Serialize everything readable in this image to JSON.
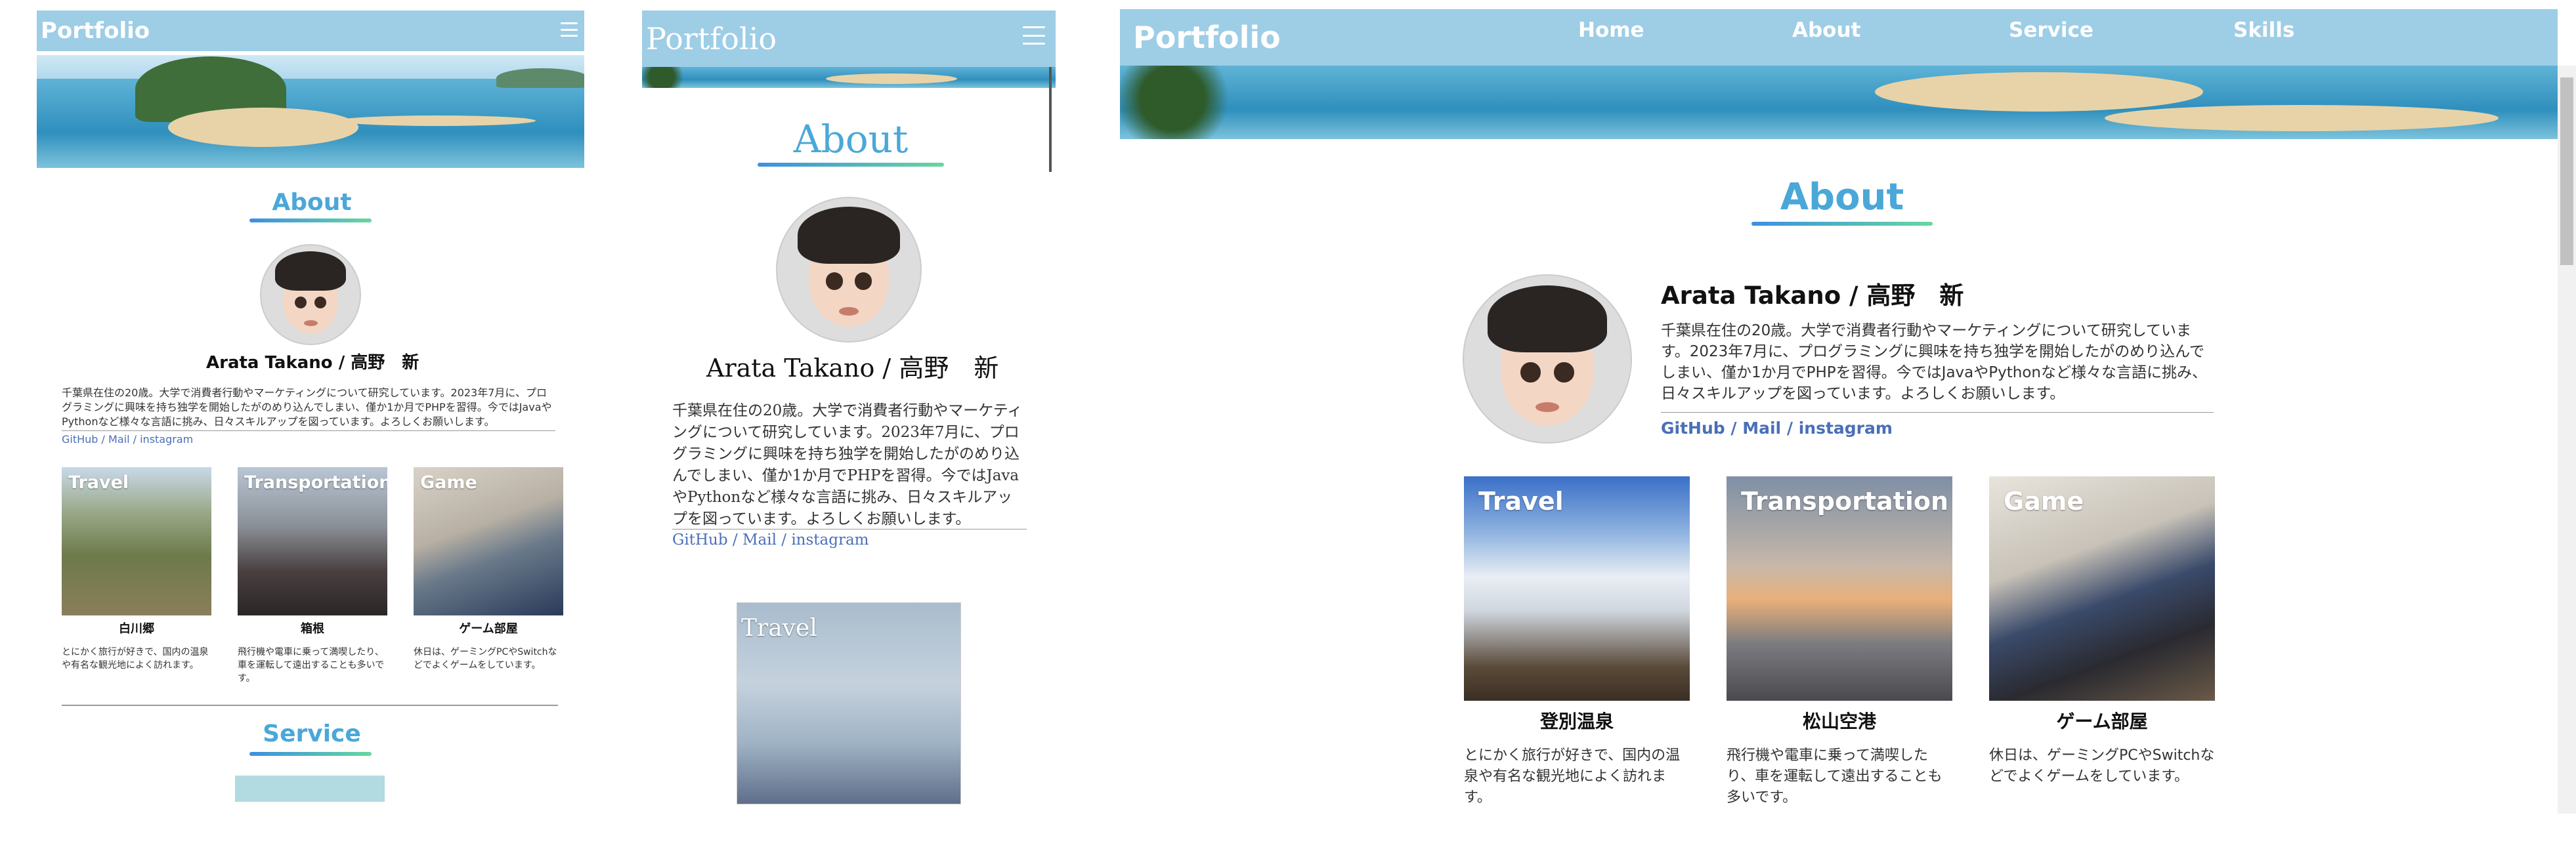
{
  "colors": {
    "header": "#9ecde6",
    "accent": "#4aa8d8",
    "link": "#4a6fb8"
  },
  "logo": "Portfolio",
  "nav": [
    "Home",
    "About",
    "Service",
    "Skills"
  ],
  "about": {
    "title": "About",
    "name": "Arata Takano / 高野　新",
    "bio": "千葉県在住の20歳。大学で消費者行動やマーケティングについて研究しています。2023年7月に、プログラミングに興味を持ち独学を開始したがのめり込んでしまい、僅か1か月でPHPを習得。今ではJavaやPythonなど様々な言語に挑み、日々スキルアップを図っています。よろしくお願いします。",
    "links": {
      "github": "GitHub",
      "mail": "Mail",
      "instagram": "instagram",
      "sep": "/"
    }
  },
  "service": {
    "title": "Service"
  },
  "mobile": {
    "cards": [
      {
        "label": "Travel",
        "caption": "白川郷",
        "desc": "とにかく旅行が好きで、国内の温泉や有名な観光地によく訪れます。"
      },
      {
        "label": "Transportation",
        "caption": "箱根",
        "desc": "飛行機や電車に乗って満喫したり、車を運転して遠出することも多いです。"
      },
      {
        "label": "Game",
        "caption": "ゲーム部屋",
        "desc": "休日は、ゲーミングPCやSwitchなどでよくゲームをしています。"
      }
    ]
  },
  "tablet": {
    "cards": [
      {
        "label": "Travel"
      }
    ]
  },
  "desktop": {
    "cards": [
      {
        "label": "Travel",
        "caption": "登別温泉",
        "desc": "とにかく旅行が好きで、国内の温泉や有名な観光地によく訪れます。"
      },
      {
        "label": "Transportation",
        "caption": "松山空港",
        "desc": "飛行機や電車に乗って満喫したり、車を運転して遠出することも多いです。"
      },
      {
        "label": "Game",
        "caption": "ゲーム部屋",
        "desc": "休日は、ゲーミングPCやSwitchなどでよくゲームをしています。"
      }
    ]
  },
  "icons": {
    "menu": "hamburger-menu-icon"
  }
}
